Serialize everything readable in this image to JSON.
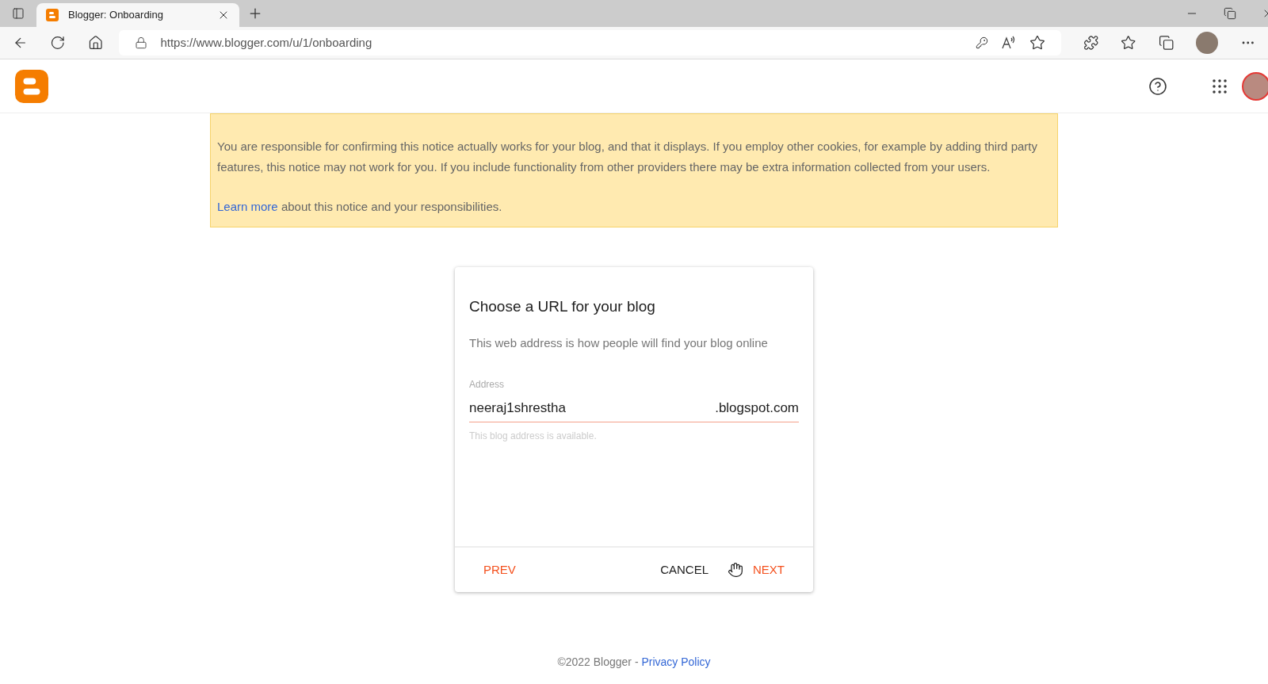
{
  "browser": {
    "tab_title": "Blogger: Onboarding",
    "url": "https://www.blogger.com/u/1/onboarding"
  },
  "notice": {
    "text": "You are responsible for confirming this notice actually works for your blog, and that it displays. If you employ other cookies, for example by adding third party features, this notice may not work for you. If you include functionality from other providers there may be extra information collected from your users.",
    "link": "Learn more",
    "link_tail": "about this notice and your responsibilities."
  },
  "dialog": {
    "title": "Choose a URL for your blog",
    "subtitle": "This web address is how people will find your blog online",
    "field": {
      "label": "Address",
      "value": "neeraj1shrestha",
      "suffix": ".blogspot.com",
      "hint": "This blog address is available."
    },
    "buttons": [
      {
        "label": "PREV",
        "kind": "accent"
      },
      {
        "label": "CANCEL",
        "kind": "plain"
      },
      {
        "label": "NEXT",
        "kind": "accent"
      }
    ]
  },
  "footer": {
    "text": "©2022 Blogger -",
    "link": "Privacy Policy"
  }
}
